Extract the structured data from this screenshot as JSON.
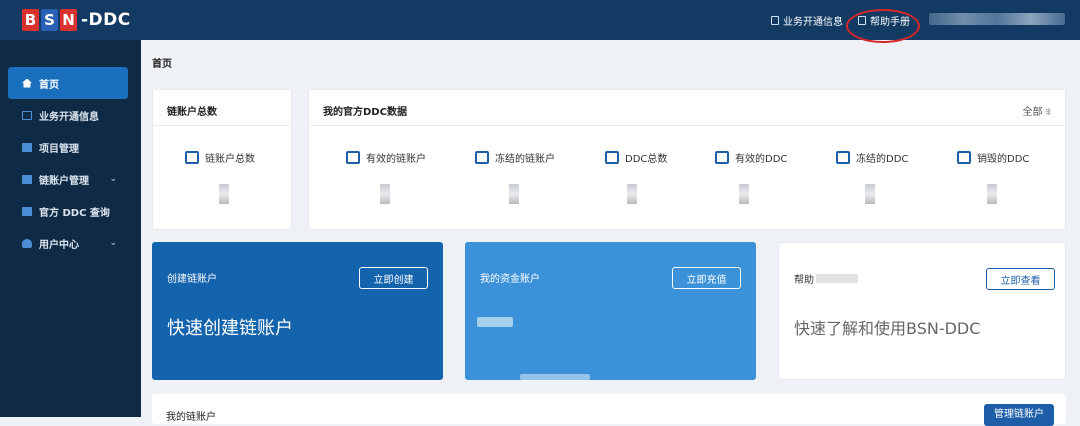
{
  "logo": {
    "l1": "B",
    "l2": "S",
    "l3": "N",
    "suffix": "-DDC"
  },
  "sidebar": {
    "items": [
      {
        "label": "首页",
        "icon": "home-icon"
      },
      {
        "label": "业务开通信息",
        "icon": "document-icon"
      },
      {
        "label": "项目管理",
        "icon": "project-icon"
      },
      {
        "label": "链账户管理",
        "icon": "account-icon"
      },
      {
        "label": "官方 DDC 查询",
        "icon": "search-list-icon"
      },
      {
        "label": "用户中心",
        "icon": "user-icon"
      }
    ],
    "chevron": "⌄"
  },
  "header": {
    "business_info": "业务开通信息",
    "help_manual": "帮助手册"
  },
  "breadcrumb": "首页",
  "chain_total_card": {
    "title": "链账户总数",
    "stat_label": "链账户总数"
  },
  "ddc_card": {
    "title": "我的官方DDC数据",
    "filter": "全部",
    "stats": [
      "有效的链账户",
      "冻结的链账户",
      "DDC总数",
      "有效的DDC",
      "冻结的DDC",
      "销毁的DDC"
    ]
  },
  "create_card": {
    "title": "创建链账户",
    "button": "立即创建",
    "big_text": "快速创建链账户"
  },
  "fund_card": {
    "title": "我的资金账户",
    "button": "立即充值"
  },
  "help_card": {
    "title": "帮助",
    "button": "立即查看",
    "big_text": "快速了解和使用BSN-DDC"
  },
  "bottom_card": {
    "title": "我的链账户",
    "button": "管理链账户"
  },
  "colors": {
    "sidebar_bg": "#0f2a44",
    "header_bg": "#123a63",
    "active_nav": "#1a6fbd",
    "create_card": "#1463ad",
    "fund_card": "#3b92d8",
    "accent_blue": "#1e5ea8",
    "highlight_red": "#d62828"
  }
}
